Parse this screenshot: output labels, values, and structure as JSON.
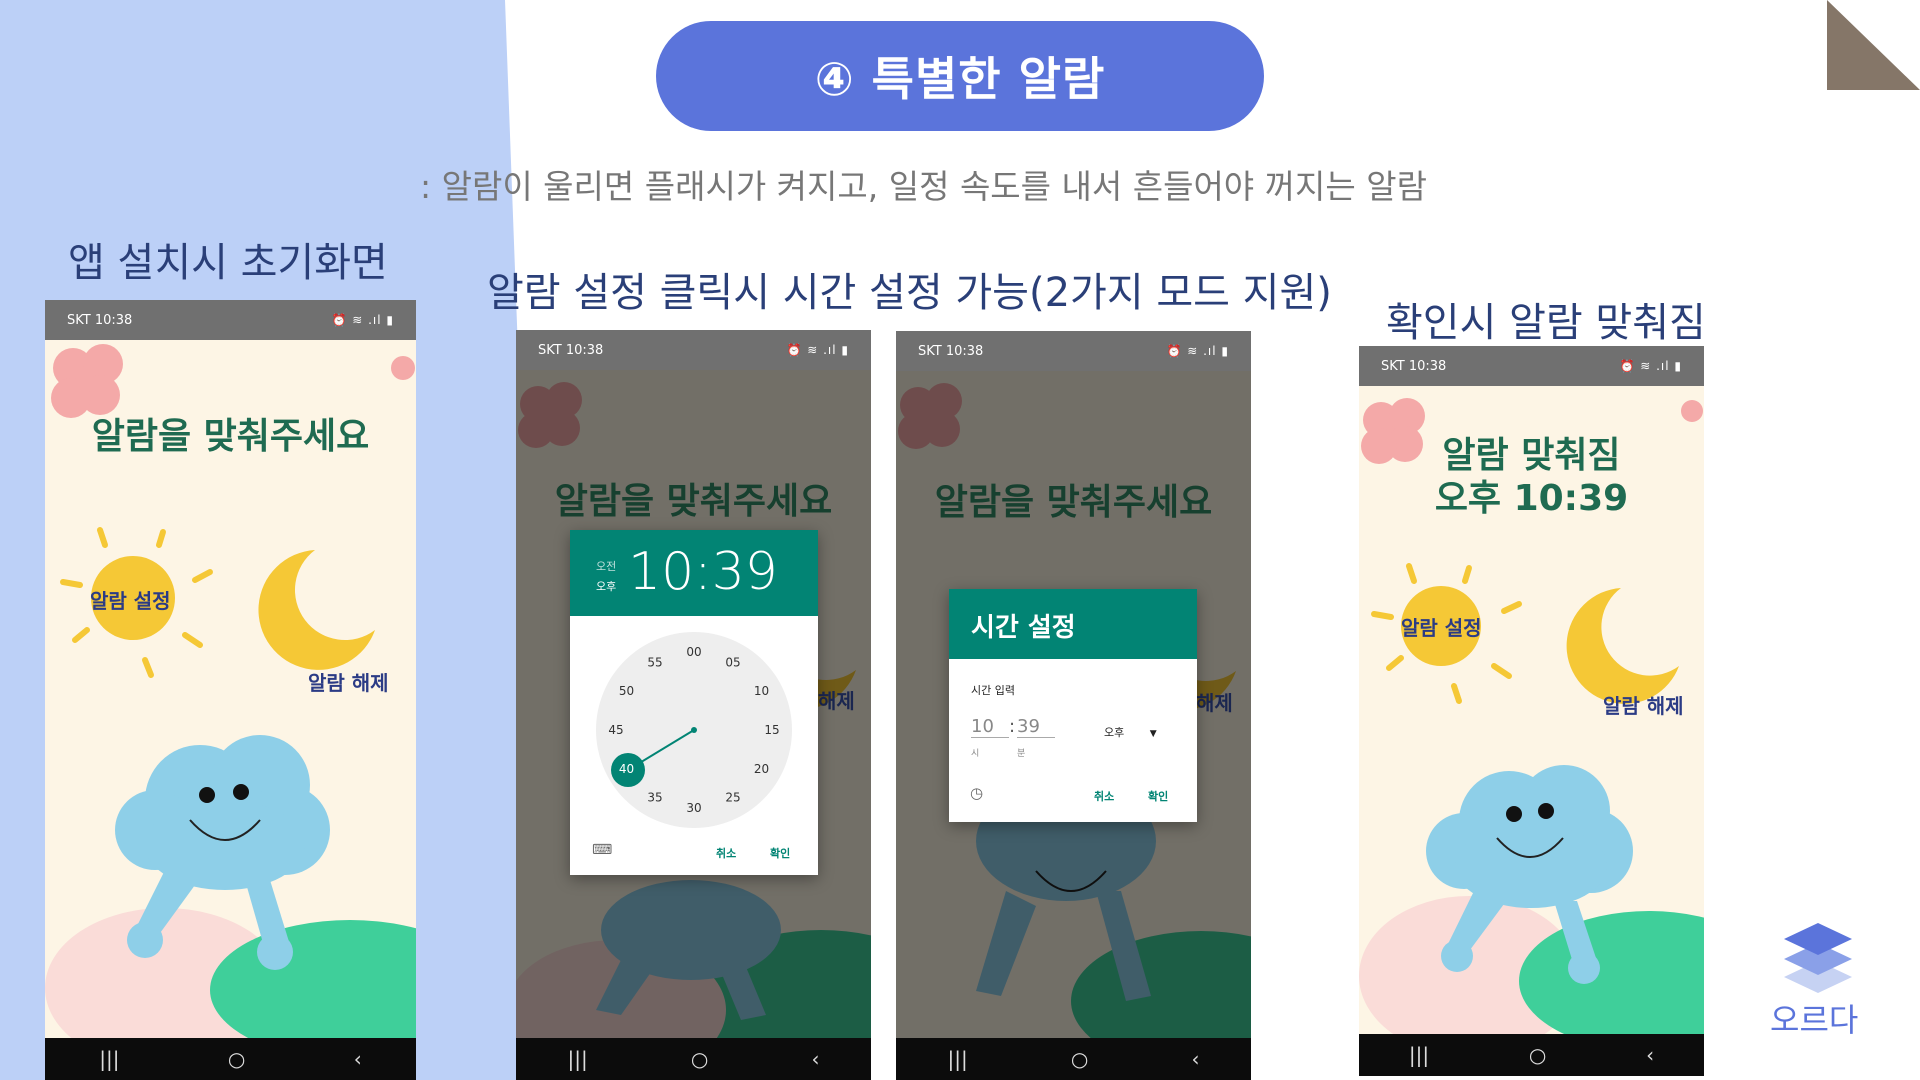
{
  "slide": {
    "title": "④ 특별한 알람",
    "subtitle": ": 알람이 울리면 플래시가 켜지고, 일정 속도를 내서 흔들어야 꺼지는 알람",
    "brand": "오르다"
  },
  "labels": {
    "initial": "앱 설치시 초기화면",
    "setting": "알람 설정 클릭시 시간 설정 가능(2가지 모드 지원)",
    "confirm": "확인시 알람 맞춰짐"
  },
  "status_bar": {
    "carrier_time": "SKT 10:38",
    "right_icons": "⏰ ≋ .ıl ▮"
  },
  "phones": {
    "p1": {
      "heading": "알람을 맞춰주세요",
      "sun_button": "알람 설정",
      "moon_button": "알람 해제"
    },
    "p2": {
      "heading": "알람을 맞춰주세요",
      "moon_button": "해제",
      "dialog": {
        "am": "오전",
        "pm": "오후",
        "time": "10:39",
        "cancel": "취소",
        "ok": "확인",
        "clock_numbers": [
          "00",
          "05",
          "10",
          "15",
          "20",
          "25",
          "30",
          "35",
          "40",
          "45",
          "50",
          "55"
        ],
        "selected_minute": "40"
      }
    },
    "p3": {
      "heading": "알람을 맞춰주세요",
      "moon_button": "해제",
      "dialog": {
        "title": "시간 설정",
        "input_label": "시간 입력",
        "hour": "10",
        "colon": ":",
        "minute": "39",
        "hour_label": "시",
        "minute_label": "분",
        "ampm": "오후",
        "cancel": "취소",
        "ok": "확인"
      }
    },
    "p4": {
      "heading_line1": "알람 맞춰짐",
      "heading_line2": "오후 10:39",
      "sun_button": "알람 설정",
      "moon_button": "알람 해제"
    }
  },
  "nav": {
    "recent": "|||",
    "home": "○",
    "back": "‹"
  }
}
